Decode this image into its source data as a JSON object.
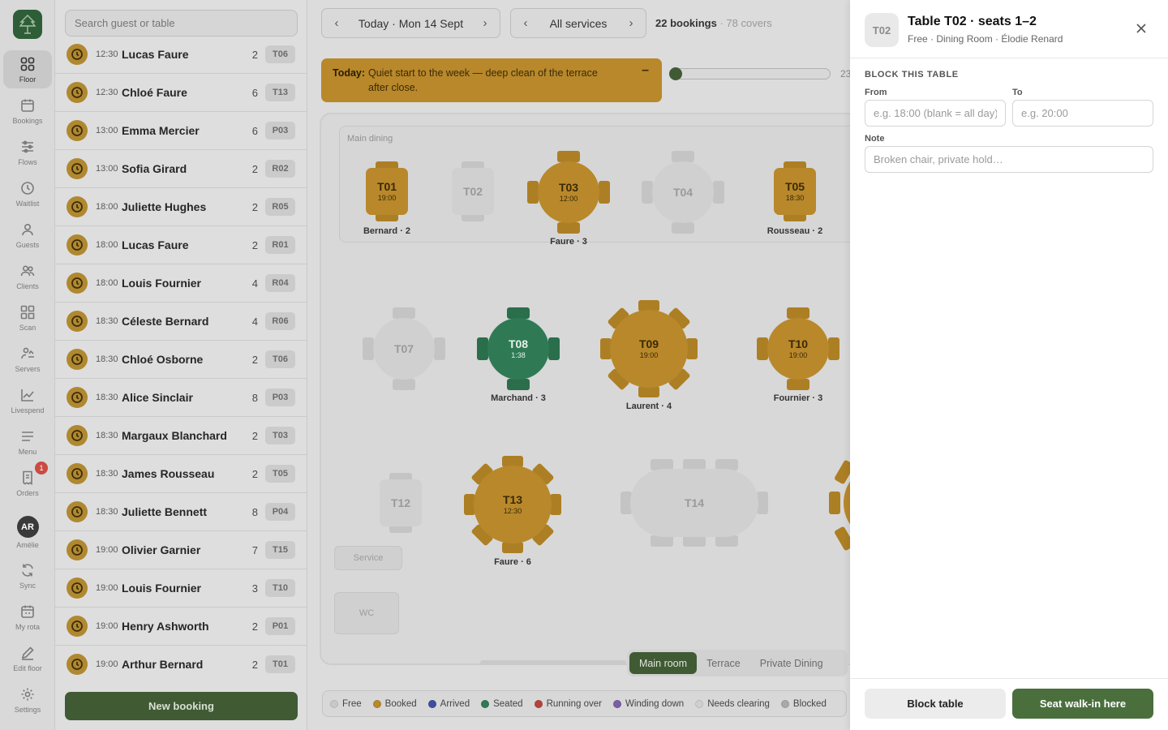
{
  "nav": {
    "items": [
      {
        "label": "Floor",
        "icon": "grid-icon",
        "active": true
      },
      {
        "label": "Bookings",
        "icon": "calendar-icon"
      },
      {
        "label": "Flows",
        "icon": "sliders-icon"
      },
      {
        "label": "Waitlist",
        "icon": "clock-icon"
      },
      {
        "label": "Guests",
        "icon": "person-icon"
      },
      {
        "label": "Clients",
        "icon": "people-icon"
      },
      {
        "label": "Scan",
        "icon": "scan-icon"
      },
      {
        "label": "Servers",
        "icon": "servers-icon"
      },
      {
        "label": "Livespend",
        "icon": "line-chart-icon"
      },
      {
        "label": "Menu",
        "icon": "menu-lines-icon"
      },
      {
        "label": "Orders",
        "icon": "receipt-icon",
        "badge": "1"
      },
      {
        "label": "Amélie",
        "avatar": "AR"
      },
      {
        "label": "Sync",
        "icon": "sync-icon"
      },
      {
        "label": "My rota",
        "icon": "rota-icon"
      },
      {
        "label": "Edit floor",
        "icon": "pen-icon"
      },
      {
        "label": "Settings",
        "icon": "gear-icon"
      }
    ]
  },
  "list": {
    "search_placeholder": "Search guest or table",
    "new_booking": "New booking",
    "rows": [
      {
        "time": "12:30",
        "name": "Lucas Faure",
        "covers": "2",
        "table": "T06"
      },
      {
        "time": "12:30",
        "name": "Chloé Faure",
        "covers": "6",
        "table": "T13"
      },
      {
        "time": "13:00",
        "name": "Emma Mercier",
        "covers": "6",
        "table": "P03"
      },
      {
        "time": "13:00",
        "name": "Sofia Girard",
        "covers": "2",
        "table": "R02"
      },
      {
        "time": "18:00",
        "name": "Juliette Hughes",
        "covers": "2",
        "table": "R05"
      },
      {
        "time": "18:00",
        "name": "Lucas Faure",
        "covers": "2",
        "table": "R01"
      },
      {
        "time": "18:00",
        "name": "Louis Fournier",
        "covers": "4",
        "table": "R04"
      },
      {
        "time": "18:30",
        "name": "Céleste Bernard",
        "covers": "4",
        "table": "R06"
      },
      {
        "time": "18:30",
        "name": "Chloé Osborne",
        "covers": "2",
        "table": "T06"
      },
      {
        "time": "18:30",
        "name": "Alice Sinclair",
        "covers": "8",
        "table": "P03"
      },
      {
        "time": "18:30",
        "name": "Margaux Blanchard",
        "covers": "2",
        "table": "T03"
      },
      {
        "time": "18:30",
        "name": "James Rousseau",
        "covers": "2",
        "table": "T05"
      },
      {
        "time": "18:30",
        "name": "Juliette Bennett",
        "covers": "8",
        "table": "P04"
      },
      {
        "time": "19:00",
        "name": "Olivier Garnier",
        "covers": "7",
        "table": "T15"
      },
      {
        "time": "19:00",
        "name": "Louis Fournier",
        "covers": "3",
        "table": "T10"
      },
      {
        "time": "19:00",
        "name": "Henry Ashworth",
        "covers": "2",
        "table": "P01"
      },
      {
        "time": "19:00",
        "name": "Arthur Bernard",
        "covers": "2",
        "table": "T01"
      }
    ]
  },
  "topbar": {
    "date": "Today · Mon 14 Sept",
    "service": "All services",
    "bookings": "22 bookings",
    "covers": "· 78 covers"
  },
  "alert": {
    "label": "Today:",
    "text": "Quiet start to the week — deep clean of the terrace after close.",
    "collapse": "–"
  },
  "timeline": {
    "value_label": "23"
  },
  "floor": {
    "zone_label": "Main dining",
    "tables": [
      {
        "id": "T01",
        "time": "19:00",
        "guest": "Bernard · 2",
        "status": "booked"
      },
      {
        "id": "T02",
        "time": "",
        "guest": "",
        "status": "free"
      },
      {
        "id": "T03",
        "time": "12:00",
        "guest": "Faure · 3",
        "status": "booked"
      },
      {
        "id": "T04",
        "time": "",
        "guest": "",
        "status": "free"
      },
      {
        "id": "T05",
        "time": "18:30",
        "guest": "Rousseau · 2",
        "status": "booked"
      },
      {
        "id": "T07",
        "time": "",
        "guest": "",
        "status": "free"
      },
      {
        "id": "T08",
        "time": "1:38",
        "guest": "Marchand · 3",
        "status": "seated"
      },
      {
        "id": "T09",
        "time": "19:00",
        "guest": "Laurent · 4",
        "status": "booked"
      },
      {
        "id": "T10",
        "time": "19:00",
        "guest": "Fournier · 3",
        "status": "booked"
      },
      {
        "id": "T12",
        "time": "",
        "guest": "",
        "status": "free"
      },
      {
        "id": "T13",
        "time": "12:30",
        "guest": "Faure · 6",
        "status": "booked"
      },
      {
        "id": "T14",
        "time": "",
        "guest": "",
        "status": "free"
      }
    ],
    "fixtures": {
      "service": "Service",
      "wc": "WC"
    },
    "room_tabs": [
      "Main room",
      "Terrace",
      "Private Dining"
    ],
    "active_room": "Main room"
  },
  "legend": [
    {
      "label": "Free",
      "color": "#c9c9c9"
    },
    {
      "label": "Booked",
      "color": "#b8882b"
    },
    {
      "label": "Arrived",
      "color": "#3e4f9e"
    },
    {
      "label": "Seated",
      "color": "#2f7a55"
    },
    {
      "label": "Running over",
      "color": "#b5433c"
    },
    {
      "label": "Winding down",
      "color": "#7a5ea6"
    },
    {
      "label": "Needs clearing",
      "color": "#cfcfcf"
    },
    {
      "label": "Blocked",
      "color": "#a9a9a9"
    }
  ],
  "drawer": {
    "badge": "T02",
    "title": "Table T02 · seats 1–2",
    "subtitle": "Free · Dining Room · Élodie Renard",
    "section": "BLOCK THIS TABLE",
    "from_label": "From",
    "from_placeholder": "e.g. 18:00 (blank = all day)",
    "to_label": "To",
    "to_placeholder": "e.g. 20:00",
    "note_label": "Note",
    "note_placeholder": "Broken chair, private hold…",
    "block_button": "Block table",
    "seat_button": "Seat walk-in here"
  },
  "colors": {
    "brand_green": "#405a34",
    "booked": "#b8882b",
    "seated": "#2f7a55",
    "free": "#d0d0d0"
  }
}
